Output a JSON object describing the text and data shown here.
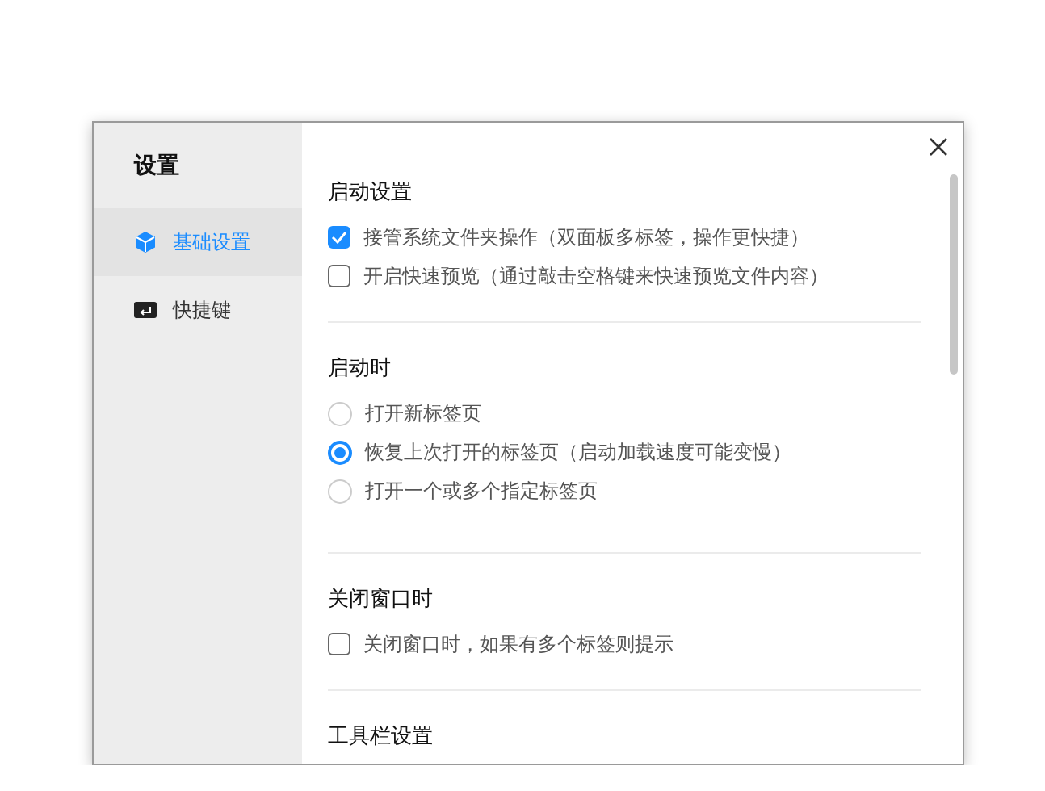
{
  "window": {
    "title": "设置"
  },
  "sidebar": {
    "items": [
      {
        "label": "基础设置",
        "selected": true
      },
      {
        "label": "快捷键",
        "selected": false
      }
    ]
  },
  "sections": [
    {
      "title": "启动设置",
      "options": [
        {
          "kind": "checkbox",
          "label": "接管系统文件夹操作（双面板多标签，操作更快捷）",
          "checked": true
        },
        {
          "kind": "checkbox",
          "label": "开启快速预览（通过敲击空格键来快速预览文件内容）",
          "checked": false
        }
      ]
    },
    {
      "title": "启动时",
      "options": [
        {
          "kind": "radio",
          "label": "打开新标签页",
          "selected": false
        },
        {
          "kind": "radio",
          "label": "恢复上次打开的标签页（启动加载速度可能变慢）",
          "selected": true
        },
        {
          "kind": "radio",
          "label": "打开一个或多个指定标签页",
          "selected": false
        }
      ]
    },
    {
      "title": "关闭窗口时",
      "options": [
        {
          "kind": "checkbox",
          "label": "关闭窗口时，如果有多个标签则提示",
          "checked": false
        }
      ]
    },
    {
      "title": "工具栏设置"
    }
  ]
}
